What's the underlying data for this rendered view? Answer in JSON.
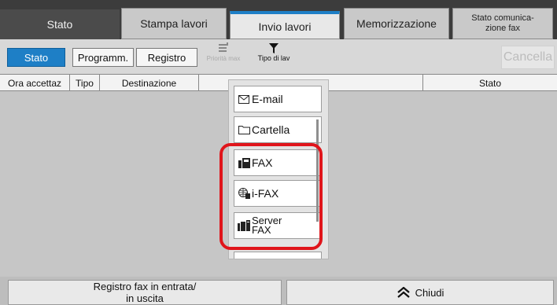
{
  "tabs": [
    {
      "label": "Stato"
    },
    {
      "label": "Stampa lavori"
    },
    {
      "label": "Invio lavori"
    },
    {
      "label": "Memorizzazione"
    },
    {
      "label": "Stato comunica-\nzione fax"
    }
  ],
  "toolbar": {
    "stato": "Stato",
    "programm": "Programm.",
    "registro": "Registro",
    "priority": "Priorità max",
    "job_type": "Tipo di lav",
    "cancel": "Cancella"
  },
  "table": {
    "columns": [
      "Ora accettaz",
      "Tipo",
      "Destinazione",
      "Stato"
    ]
  },
  "dropdown": {
    "items": [
      {
        "label": "E-mail",
        "icon": "envelope-icon"
      },
      {
        "label": "Cartella",
        "icon": "folder-icon"
      },
      {
        "label": "FAX",
        "icon": "fax-icon"
      },
      {
        "label": "i-FAX",
        "icon": "globe-fax-icon"
      },
      {
        "label": "Server FAX",
        "label_line1": "Server",
        "label_line2": "FAX",
        "icon": "server-fax-icon"
      }
    ]
  },
  "bottom": {
    "fax_log": "Registro fax in entrata/\nin uscita",
    "close": "Chiudi"
  },
  "colors": {
    "accent": "#1e7fc6",
    "highlight": "#e0151b"
  }
}
